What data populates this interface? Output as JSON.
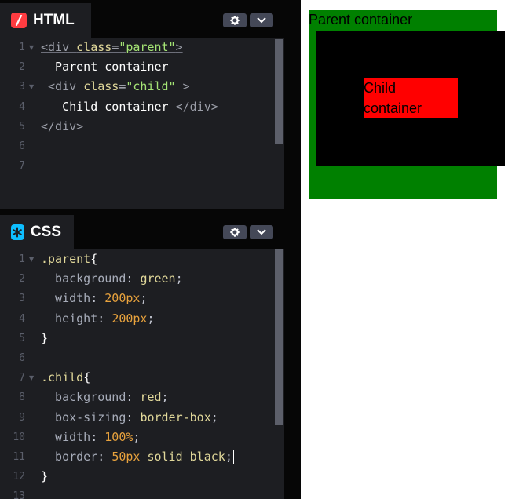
{
  "html_panel": {
    "title": "HTML",
    "icon": "html-slash-icon",
    "lines": [
      {
        "num": "1",
        "fold": true
      },
      {
        "num": "2"
      },
      {
        "num": "3",
        "fold": true
      },
      {
        "num": "4"
      },
      {
        "num": "5"
      },
      {
        "num": "6"
      },
      {
        "num": "7"
      }
    ],
    "code": {
      "l1_open": "<div ",
      "l1_attr": "class",
      "l1_eq": "=",
      "l1_str": "\"parent\"",
      "l1_close": ">",
      "l2_text": "  Parent container",
      "l3_open": " <div ",
      "l3_attr": "class",
      "l3_eq": "=",
      "l3_str": "\"child\"",
      "l3_close": " >",
      "l4_text": "   Child container ",
      "l4_tag": "</div>",
      "l5_tag": "</div>"
    }
  },
  "css_panel": {
    "title": "CSS",
    "icon": "css-asterisk-icon",
    "lines": [
      {
        "num": "1",
        "fold": true
      },
      {
        "num": "2"
      },
      {
        "num": "3"
      },
      {
        "num": "4"
      },
      {
        "num": "5"
      },
      {
        "num": "6"
      },
      {
        "num": "7",
        "fold": true
      },
      {
        "num": "8"
      },
      {
        "num": "9"
      },
      {
        "num": "10"
      },
      {
        "num": "11"
      },
      {
        "num": "12"
      },
      {
        "num": "13"
      }
    ],
    "code": {
      "l1_sel": ".parent",
      "l1_brace": "{",
      "l2_prop": "  background",
      "l2_val": "green",
      "l3_prop": "  width",
      "l3_val": "200px",
      "l4_prop": "  height",
      "l4_val": "200px",
      "l5_brace": "}",
      "l7_sel": ".child",
      "l7_brace": "{",
      "l8_prop": "  background",
      "l8_val": "red",
      "l9_prop": "  box-sizing",
      "l9_val": "border-box",
      "l10_prop": "  width",
      "l10_val": "100%",
      "l11_prop": "  border",
      "l11_val_num": "50px",
      "l11_val_kw": "solid black",
      "l12_brace": "}",
      "colon": ": ",
      "semi": ";"
    }
  },
  "controls": {
    "settings_icon": "gear-icon",
    "collapse_icon": "chevron-down-icon"
  },
  "preview": {
    "parent_text": "Parent container",
    "child_text": "Child container",
    "parent_color": "#008000",
    "child_color": "#ff0000",
    "border_color": "#000000"
  }
}
